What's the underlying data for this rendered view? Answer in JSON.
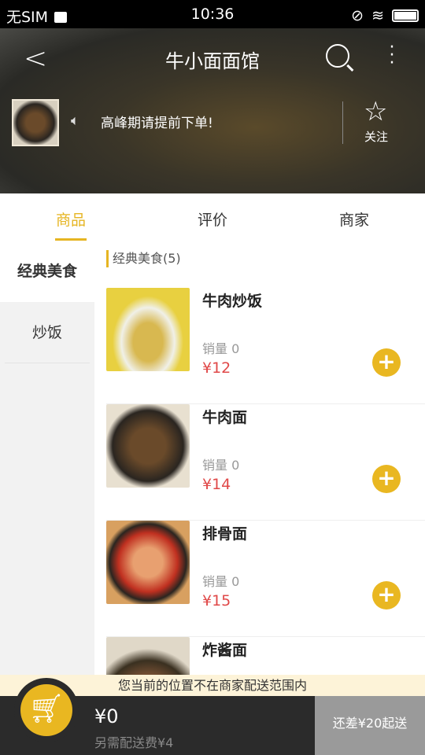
{
  "status": {
    "carrier": "无SIM",
    "time": "10:36"
  },
  "header": {
    "title": "牛小面面馆",
    "notice": "高峰期请提前下单!",
    "follow": "关注"
  },
  "tabs": [
    "商品",
    "评价",
    "商家"
  ],
  "sidebar": [
    "经典美食",
    "炒饭"
  ],
  "section": "经典美食(5)",
  "items": [
    {
      "name": "牛肉炒饭",
      "sales": "销量 0",
      "price": "¥12"
    },
    {
      "name": "牛肉面",
      "sales": "销量 0",
      "price": "¥14"
    },
    {
      "name": "排骨面",
      "sales": "销量 0",
      "price": "¥15"
    },
    {
      "name": "炸酱面"
    }
  ],
  "banner": "您当前的位置不在商家配送范围内",
  "cart": {
    "total": "¥0",
    "fee": "另需配送费¥4",
    "checkout": "还差¥20起送"
  },
  "colors": {
    "accent": "#e9b721",
    "price": "#e04848"
  }
}
